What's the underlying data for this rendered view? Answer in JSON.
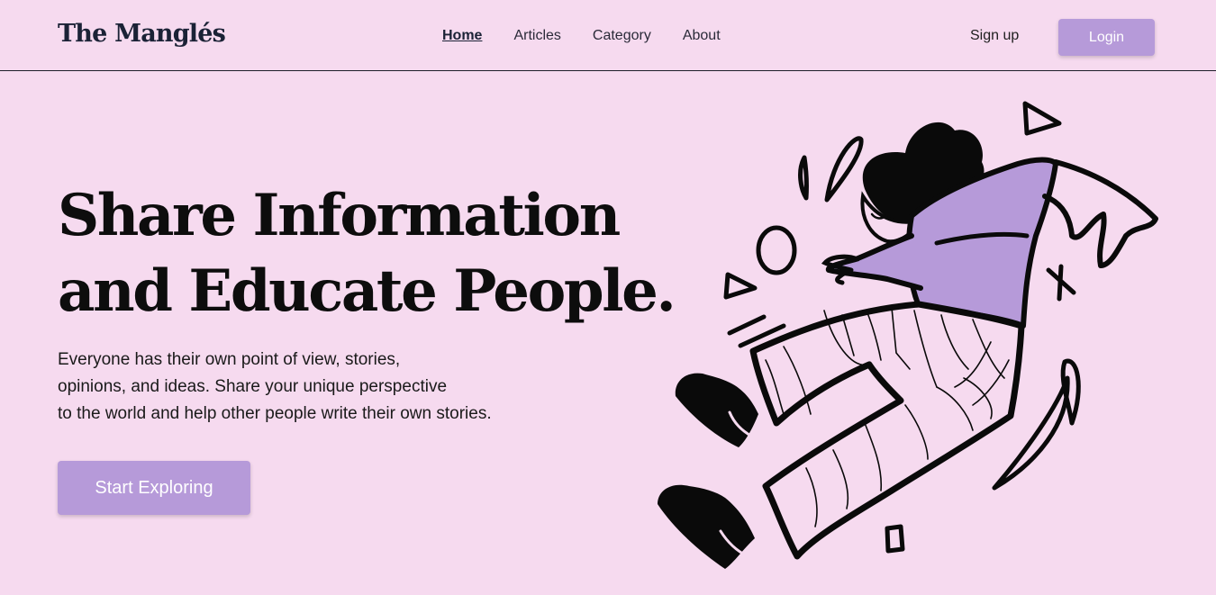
{
  "header": {
    "brand": "The Manglés",
    "nav": [
      {
        "label": "Home",
        "active": true
      },
      {
        "label": "Articles",
        "active": false
      },
      {
        "label": "Category",
        "active": false
      },
      {
        "label": "About",
        "active": false
      }
    ],
    "signup_label": "Sign up",
    "login_label": "Login"
  },
  "hero": {
    "title_lines": [
      "Share Information",
      "and Educate People."
    ],
    "description_lines": [
      "Everyone has their own point of view, stories,",
      "opinions, and ideas. Share your unique perspective",
      "to the world and help other people write their own stories."
    ],
    "cta_label": "Start Exploring",
    "illustration_icon": "jumping-person-illustration"
  },
  "colors": {
    "background": "#f6daef",
    "accent": "#b69ad9",
    "brand_text": "#1b2236"
  }
}
